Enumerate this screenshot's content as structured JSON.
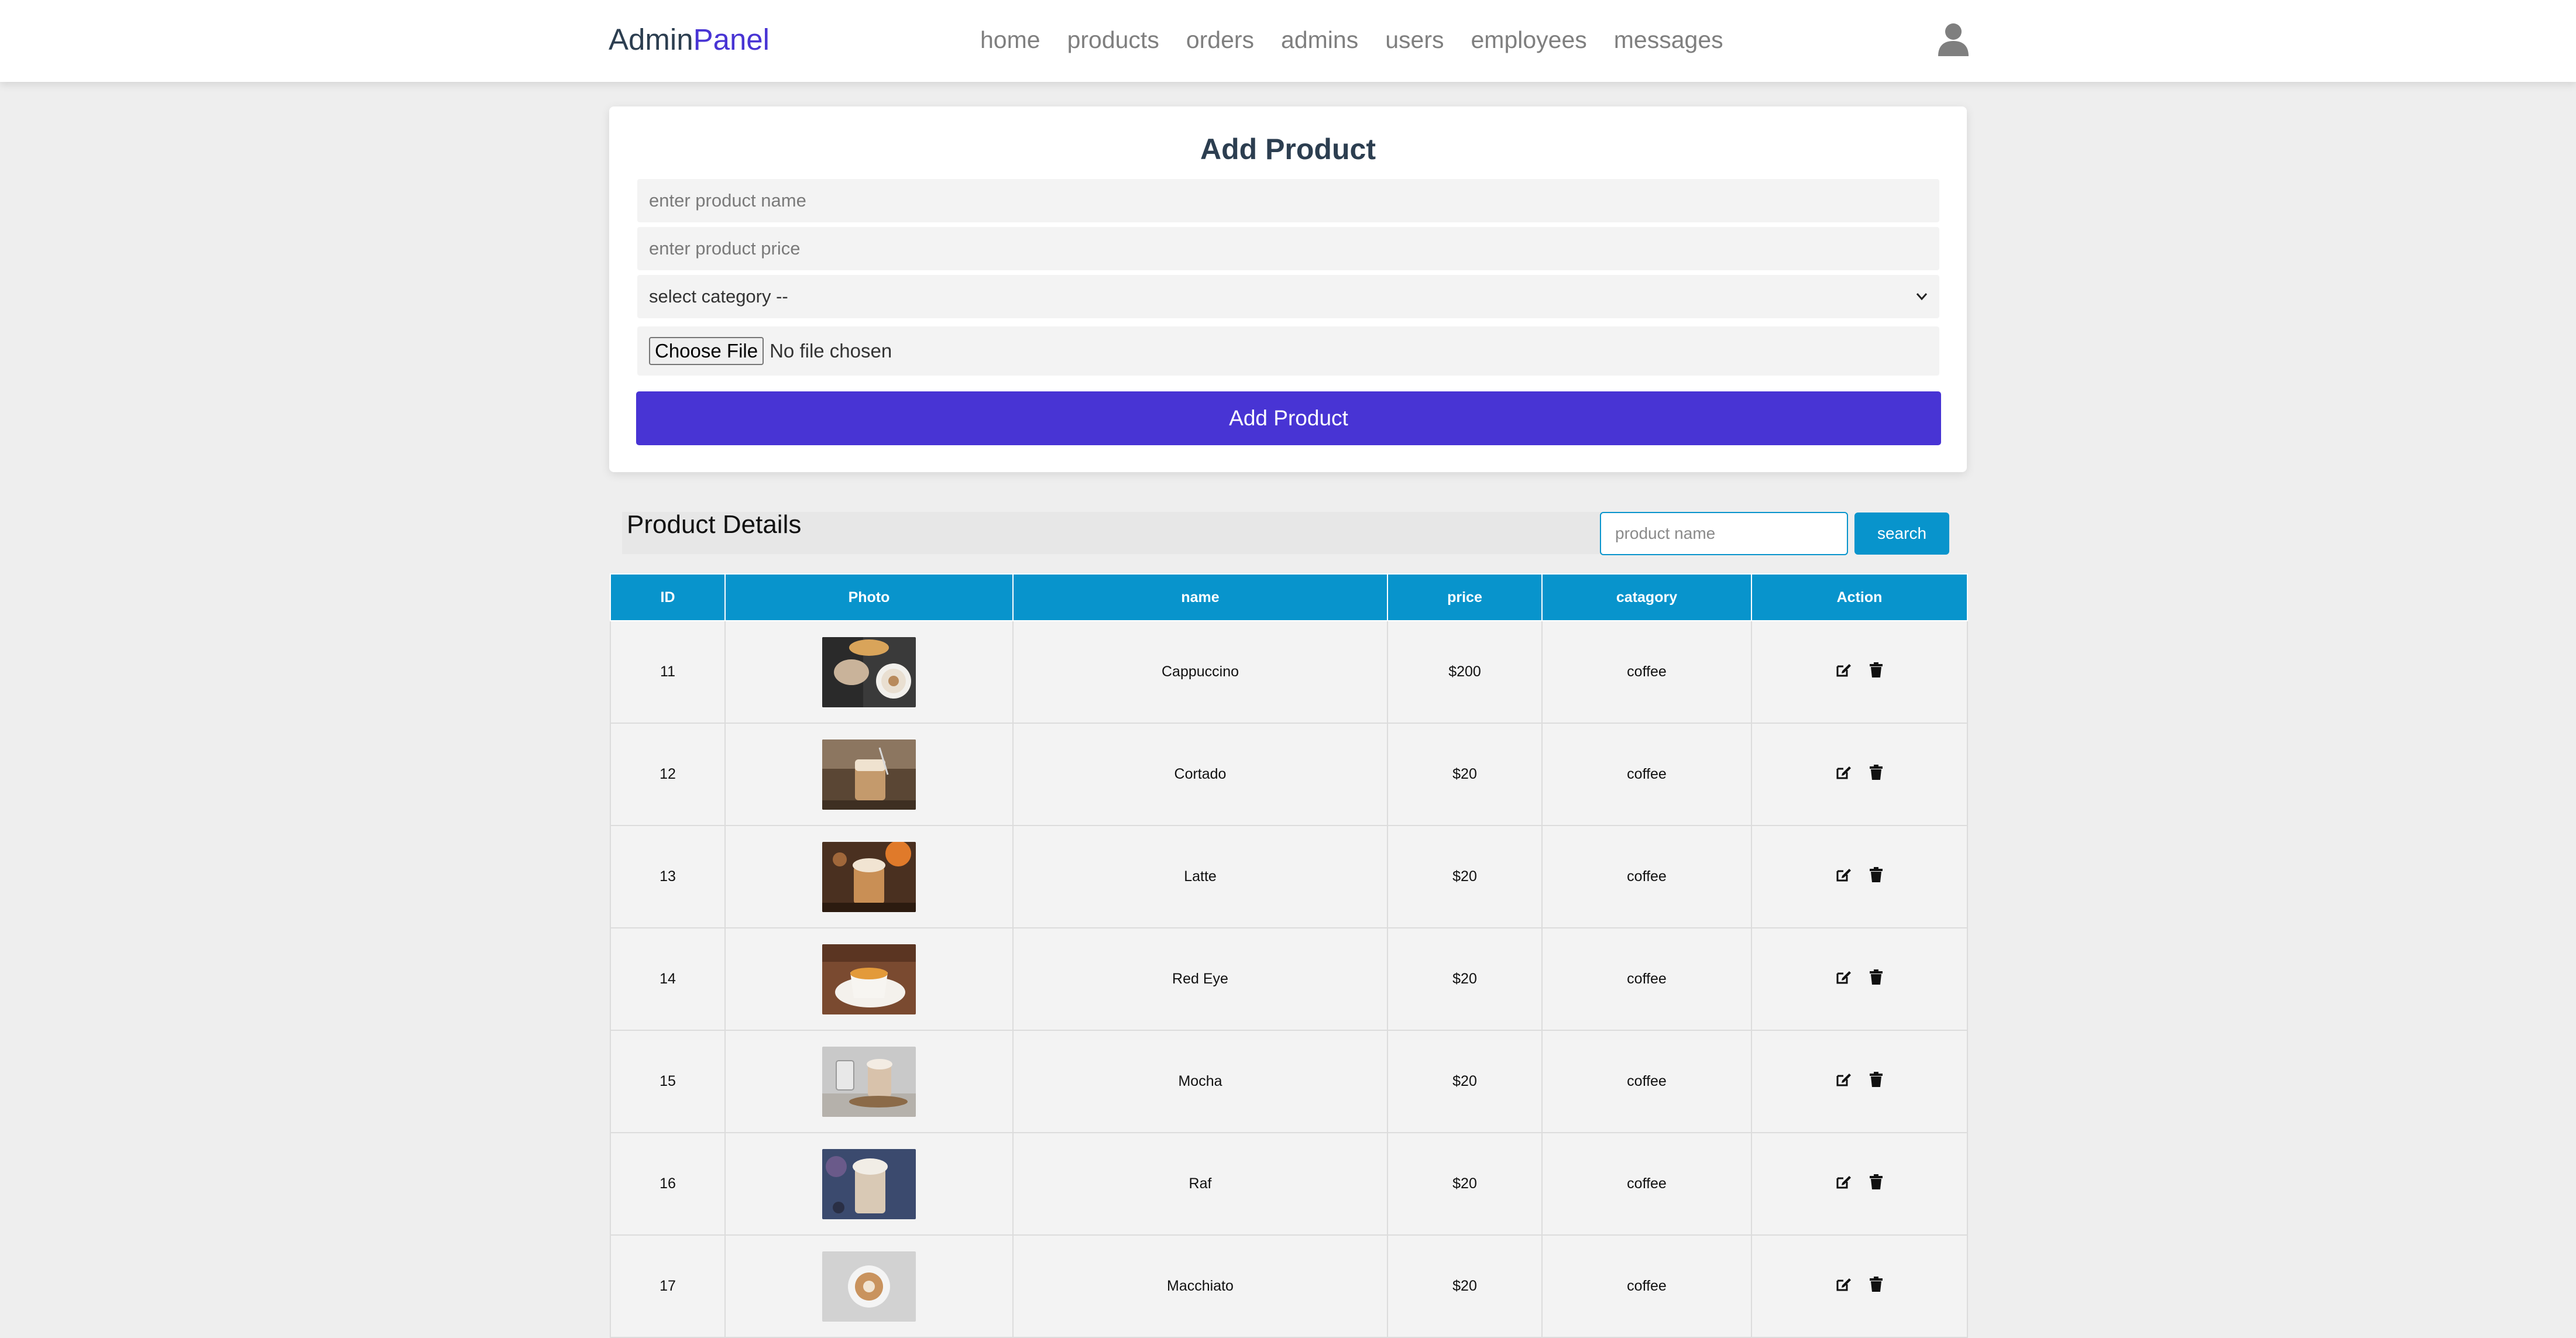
{
  "header": {
    "logo_part1": "Admin",
    "logo_part2": "Panel",
    "nav": [
      "home",
      "products",
      "orders",
      "admins",
      "users",
      "employees",
      "messages"
    ],
    "user_icon": "user-icon"
  },
  "add_product": {
    "title": "Add Product",
    "name_placeholder": "enter product name",
    "price_placeholder": "enter product price",
    "category_selected": "select category --",
    "file_button": "Choose File",
    "file_status": "No file chosen",
    "submit_label": "Add Product"
  },
  "details": {
    "title": "Product Details",
    "search_placeholder": "product name",
    "search_label": "search"
  },
  "table": {
    "headers": [
      "ID",
      "Photo",
      "name",
      "price",
      "catagory",
      "Action"
    ],
    "rows": [
      {
        "id": "11",
        "name": "Cappuccino",
        "price": "$200",
        "category": "coffee"
      },
      {
        "id": "12",
        "name": "Cortado",
        "price": "$20",
        "category": "coffee"
      },
      {
        "id": "13",
        "name": "Latte",
        "price": "$20",
        "category": "coffee"
      },
      {
        "id": "14",
        "name": "Red Eye",
        "price": "$20",
        "category": "coffee"
      },
      {
        "id": "15",
        "name": "Mocha",
        "price": "$20",
        "category": "coffee"
      },
      {
        "id": "16",
        "name": "Raf",
        "price": "$20",
        "category": "coffee"
      },
      {
        "id": "17",
        "name": "Macchiato",
        "price": "$20",
        "category": "coffee"
      }
    ]
  },
  "colors": {
    "brand": "#4834d4",
    "table_header": "#0894cc",
    "logo_dark": "#2c3e50"
  }
}
